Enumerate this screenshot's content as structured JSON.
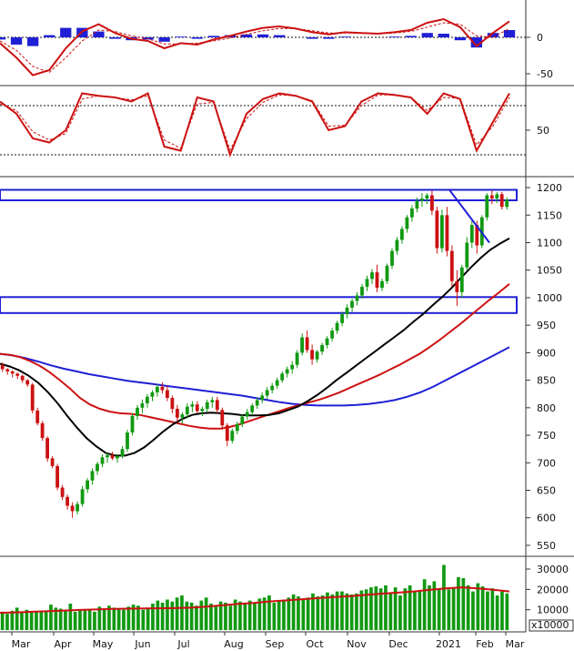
{
  "chart_data": [
    {
      "type": "line",
      "panel": "macd",
      "y_ticks": [
        0,
        -50
      ],
      "series": [
        {
          "role": "macd_line",
          "color": "#cc1111",
          "values": [
            -8,
            -28,
            -52,
            -45,
            -15,
            8,
            18,
            6,
            -2,
            -5,
            -15,
            -8,
            -10,
            -3,
            2,
            8,
            13,
            15,
            12,
            7,
            4,
            7,
            6,
            5,
            7,
            10,
            20,
            25,
            14,
            -12,
            6,
            22
          ]
        },
        {
          "role": "signal_line",
          "color": "#cc1111",
          "style": "dashed",
          "values": [
            -5,
            -18,
            -40,
            -48,
            -28,
            -5,
            10,
            8,
            2,
            -2,
            -9,
            -9,
            -8,
            -5,
            -1,
            4,
            9,
            12,
            12,
            9,
            6,
            6,
            6,
            5,
            6,
            8,
            14,
            20,
            18,
            2,
            0,
            12
          ]
        },
        {
          "role": "histogram",
          "color": "#1f1fd6",
          "values": [
            -3,
            -10,
            -12,
            3,
            13,
            13,
            8,
            -2,
            -4,
            -3,
            -6,
            1,
            -2,
            2,
            3,
            4,
            4,
            3,
            0,
            -2,
            -2,
            1,
            0,
            0,
            1,
            2,
            6,
            5,
            -4,
            -14,
            6,
            10
          ]
        }
      ]
    },
    {
      "type": "line",
      "panel": "oscillator",
      "y_ticks": [
        50
      ],
      "series": [
        {
          "role": "oscillator",
          "color": "#cc1111",
          "values": [
            85,
            70,
            40,
            35,
            50,
            95,
            92,
            90,
            85,
            95,
            30,
            25,
            90,
            85,
            20,
            70,
            88,
            95,
            92,
            85,
            50,
            55,
            85,
            95,
            93,
            90,
            70,
            95,
            88,
            25,
            60,
            95
          ]
        },
        {
          "role": "oscillator_signal",
          "color": "#cc1111",
          "style": "dashed",
          "values": [
            82,
            74,
            48,
            38,
            46,
            88,
            92,
            90,
            87,
            92,
            38,
            28,
            82,
            84,
            26,
            64,
            84,
            93,
            92,
            86,
            55,
            56,
            80,
            93,
            93,
            90,
            74,
            90,
            89,
            32,
            55,
            90
          ]
        },
        {
          "role": "upper_level",
          "style": "dotted",
          "values": [
            80
          ]
        },
        {
          "role": "lower_level",
          "style": "dotted",
          "values": [
            20
          ]
        }
      ]
    },
    {
      "type": "candlestick",
      "panel": "price",
      "ylim": [
        540,
        1210
      ],
      "y_ticks": [
        1200,
        1150,
        1100,
        1050,
        1000,
        950,
        900,
        850,
        800,
        750,
        700,
        650,
        600,
        550
      ],
      "ohlc": [
        [
          878,
          882,
          865,
          870
        ],
        [
          870,
          872,
          860,
          866
        ],
        [
          866,
          868,
          855,
          862
        ],
        [
          862,
          864,
          852,
          858
        ],
        [
          858,
          860,
          845,
          850
        ],
        [
          850,
          852,
          838,
          842
        ],
        [
          842,
          845,
          790,
          795
        ],
        [
          795,
          800,
          768,
          772
        ],
        [
          772,
          776,
          740,
          745
        ],
        [
          745,
          748,
          702,
          708
        ],
        [
          708,
          712,
          690,
          694
        ],
        [
          694,
          698,
          650,
          655
        ],
        [
          655,
          660,
          632,
          638
        ],
        [
          638,
          642,
          615,
          622
        ],
        [
          622,
          628,
          600,
          612
        ],
        [
          612,
          630,
          606,
          625
        ],
        [
          625,
          658,
          620,
          652
        ],
        [
          652,
          672,
          645,
          668
        ],
        [
          668,
          690,
          660,
          685
        ],
        [
          685,
          702,
          678,
          698
        ],
        [
          698,
          715,
          692,
          710
        ],
        [
          710,
          718,
          700,
          714
        ],
        [
          714,
          720,
          705,
          708
        ],
        [
          708,
          716,
          700,
          712
        ],
        [
          712,
          730,
          708,
          725
        ],
        [
          725,
          760,
          720,
          755
        ],
        [
          755,
          790,
          750,
          785
        ],
        [
          785,
          805,
          778,
          800
        ],
        [
          800,
          815,
          790,
          808
        ],
        [
          808,
          825,
          800,
          820
        ],
        [
          820,
          832,
          812,
          828
        ],
        [
          828,
          842,
          820,
          838
        ],
        [
          838,
          846,
          826,
          832
        ],
        [
          832,
          840,
          812,
          818
        ],
        [
          818,
          822,
          790,
          798
        ],
        [
          798,
          805,
          775,
          782
        ],
        [
          782,
          792,
          770,
          788
        ],
        [
          788,
          808,
          782,
          802
        ],
        [
          802,
          812,
          792,
          806
        ],
        [
          806,
          812,
          790,
          794
        ],
        [
          794,
          802,
          785,
          798
        ],
        [
          798,
          815,
          792,
          810
        ],
        [
          810,
          820,
          800,
          814
        ],
        [
          814,
          820,
          790,
          796
        ],
        [
          796,
          800,
          760,
          768
        ],
        [
          768,
          772,
          730,
          740
        ],
        [
          740,
          762,
          735,
          758
        ],
        [
          758,
          775,
          752,
          770
        ],
        [
          770,
          788,
          765,
          784
        ],
        [
          784,
          798,
          778,
          792
        ],
        [
          792,
          808,
          786,
          804
        ],
        [
          804,
          818,
          798,
          814
        ],
        [
          814,
          828,
          808,
          822
        ],
        [
          822,
          838,
          816,
          832
        ],
        [
          832,
          845,
          826,
          840
        ],
        [
          840,
          855,
          834,
          850
        ],
        [
          850,
          866,
          845,
          862
        ],
        [
          862,
          875,
          855,
          870
        ],
        [
          870,
          885,
          862,
          878
        ],
        [
          878,
          905,
          872,
          900
        ],
        [
          900,
          935,
          895,
          928
        ],
        [
          928,
          940,
          900,
          905
        ],
        [
          905,
          915,
          878,
          888
        ],
        [
          888,
          905,
          882,
          902
        ],
        [
          902,
          918,
          896,
          914
        ],
        [
          914,
          930,
          908,
          926
        ],
        [
          926,
          945,
          920,
          940
        ],
        [
          940,
          958,
          934,
          954
        ],
        [
          954,
          975,
          948,
          970
        ],
        [
          970,
          988,
          962,
          982
        ],
        [
          982,
          998,
          974,
          994
        ],
        [
          994,
          1010,
          986,
          1004
        ],
        [
          1004,
          1025,
          998,
          1020
        ],
        [
          1020,
          1040,
          1012,
          1034
        ],
        [
          1034,
          1052,
          1025,
          1046
        ],
        [
          1046,
          1060,
          1010,
          1018
        ],
        [
          1018,
          1035,
          1012,
          1030
        ],
        [
          1030,
          1062,
          1025,
          1058
        ],
        [
          1058,
          1090,
          1052,
          1085
        ],
        [
          1085,
          1110,
          1078,
          1105
        ],
        [
          1105,
          1130,
          1098,
          1125
        ],
        [
          1125,
          1150,
          1118,
          1146
        ],
        [
          1146,
          1168,
          1138,
          1162
        ],
        [
          1162,
          1182,
          1155,
          1176
        ],
        [
          1176,
          1190,
          1165,
          1180
        ],
        [
          1180,
          1190,
          1170,
          1186
        ],
        [
          1186,
          1195,
          1150,
          1158
        ],
        [
          1158,
          1165,
          1080,
          1090
        ],
        [
          1090,
          1160,
          1082,
          1150
        ],
        [
          1150,
          1165,
          1075,
          1085
        ],
        [
          1085,
          1095,
          1020,
          1030
        ],
        [
          1030,
          1050,
          985,
          1010
        ],
        [
          1010,
          1060,
          1000,
          1055
        ],
        [
          1055,
          1110,
          1050,
          1100
        ],
        [
          1100,
          1140,
          1090,
          1132
        ],
        [
          1132,
          1140,
          1080,
          1095
        ],
        [
          1095,
          1150,
          1090,
          1146
        ],
        [
          1146,
          1190,
          1140,
          1186
        ],
        [
          1186,
          1195,
          1170,
          1180
        ],
        [
          1180,
          1192,
          1172,
          1188
        ],
        [
          1188,
          1192,
          1160,
          1165
        ],
        [
          1165,
          1182,
          1160,
          1178
        ]
      ],
      "moving_averages": [
        {
          "role": "ma_black",
          "color": "#000000",
          "values": [
            880,
            875,
            868,
            858,
            845,
            828,
            808,
            785,
            764,
            745,
            730,
            718,
            713,
            713,
            718,
            728,
            742,
            757,
            770,
            780,
            787,
            790,
            791,
            790,
            789,
            787,
            786,
            786,
            787,
            790,
            796,
            802,
            812,
            823,
            836,
            850,
            863,
            876,
            889,
            902,
            915,
            928,
            941,
            956,
            970,
            986,
            1001,
            1018,
            1037,
            1055,
            1072,
            1087,
            1098,
            1108
          ]
        },
        {
          "role": "ma_red",
          "color": "#cc1111",
          "values": [
            898,
            896,
            892,
            885,
            876,
            864,
            850,
            835,
            818,
            806,
            798,
            793,
            790,
            789,
            787,
            783,
            779,
            775,
            771,
            767,
            764,
            762,
            762,
            765,
            770,
            776,
            782,
            788,
            794,
            800,
            805,
            810,
            815,
            821,
            828,
            836,
            844,
            852,
            860,
            869,
            878,
            888,
            898,
            910,
            923,
            937,
            951,
            966,
            981,
            996,
            1010,
            1025
          ]
        },
        {
          "role": "ma_blue",
          "color": "#1f1fd6",
          "values": [
            898,
            895,
            890,
            884,
            877,
            871,
            866,
            861,
            857,
            853,
            849,
            846,
            843,
            840,
            837,
            834,
            831,
            828,
            825,
            822,
            818,
            814,
            810,
            807,
            805,
            804,
            804,
            804,
            805,
            807,
            810,
            814,
            820,
            828,
            838,
            850,
            862,
            874,
            886,
            898,
            910
          ]
        }
      ],
      "trendlines": [
        {
          "role": "resistance_box_top",
          "color": "#1f1fd6",
          "from": [
            "Mar",
            1196
          ],
          "to": [
            "Mar",
            1177
          ]
        },
        {
          "role": "support_box",
          "color": "#1f1fd6",
          "from": [
            "Mar",
            1001
          ],
          "to": [
            "Mar",
            972
          ]
        },
        {
          "role": "down_trendline",
          "color": "#1f1fd6",
          "from": [
            1196
          ],
          "to": [
            1100
          ]
        }
      ]
    },
    {
      "type": "bar",
      "panel": "volume",
      "unit_label": "x10000",
      "y_ticks": [
        30000,
        20000,
        10000
      ],
      "categories": [
        "Mar",
        "Apr",
        "May",
        "Jun",
        "Jul",
        "Aug",
        "Sep",
        "Oct",
        "Nov",
        "Dec",
        "2021",
        "Feb",
        "Mar"
      ],
      "values": [
        9000,
        8000,
        9500,
        11000,
        8500,
        10000,
        9000,
        8800,
        9200,
        9600,
        12500,
        11000,
        10500,
        9800,
        13000,
        9000,
        10000,
        9600,
        10200,
        9000,
        11500,
        10000,
        12000,
        11000,
        10500,
        10000,
        11500,
        12500,
        12000,
        10000,
        11000,
        13000,
        14500,
        13500,
        15000,
        14000,
        16000,
        17000,
        14000,
        13500,
        12000,
        14500,
        16000,
        13000,
        12000,
        14000,
        13500,
        12000,
        15000,
        14000,
        13000,
        14500,
        13000,
        15500,
        16000,
        17000,
        13500,
        14500,
        15000,
        16000,
        17500,
        16500,
        15000,
        16000,
        18000,
        16500,
        17000,
        18500,
        17500,
        19000,
        19000,
        18000,
        17500,
        18000,
        19500,
        20000,
        21000,
        21500,
        20500,
        22000,
        18500,
        21000,
        17000,
        20500,
        22000,
        19000,
        19500,
        25000,
        22000,
        24000,
        20000,
        32000,
        20000,
        21000,
        26000,
        25500,
        22000,
        19000,
        23000,
        21500,
        19000,
        20500,
        17000,
        19000,
        18000
      ],
      "volume_ma": [
        8500,
        8700,
        9000,
        9300,
        9600,
        9900,
        10100,
        10400,
        10500,
        10600,
        10700,
        10800,
        11000,
        11500,
        12200,
        12900,
        13400,
        14100,
        14600,
        15200,
        15700,
        16200,
        16700,
        17300,
        17900,
        18400,
        19000,
        19800,
        20500,
        21000,
        20500,
        19800,
        19000
      ]
    }
  ],
  "axis": {
    "months": [
      "Mar",
      "Apr",
      "May",
      "Jun",
      "Jul",
      "Aug",
      "Sep",
      "Oct",
      "Nov",
      "Dec",
      "2021",
      "Feb",
      "Mar"
    ]
  }
}
